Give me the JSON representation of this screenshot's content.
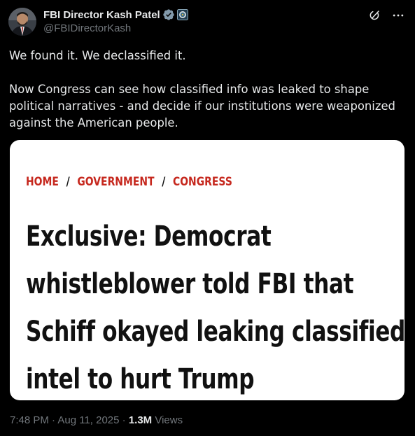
{
  "author": {
    "display_name": "FBI Director Kash Patel",
    "handle": "@FBIDirectorKash",
    "avatar_icon": "profile-photo",
    "verified_icon": "verified-badge-icon",
    "affiliate_icon": "government-seal-icon"
  },
  "actions": {
    "grok_icon": "grok-icon",
    "more_icon": "more-options-icon"
  },
  "post": {
    "line1": "We found it. We declassified it.",
    "line2": "Now Congress can see how classified info was leaked to shape political narratives - and decide if our institutions were weaponized against the American people."
  },
  "media": {
    "breadcrumbs": [
      "HOME",
      "GOVERNMENT",
      "CONGRESS"
    ],
    "separator": "/",
    "headline_lines": [
      "Exclusive: Democrat",
      "whistleblower told FBI that",
      "Schiff okayed leaking classified",
      "intel to hurt Trump"
    ]
  },
  "meta": {
    "timestamp": "7:48 PM · Aug 11, 2025 · ",
    "views_count": "1.3M",
    "views_label": " Views"
  },
  "colors": {
    "background": "#000000",
    "text_primary": "#e7e9ea",
    "text_secondary": "#71767b",
    "verified": "#829aab",
    "crumb_red": "#c6281e"
  }
}
